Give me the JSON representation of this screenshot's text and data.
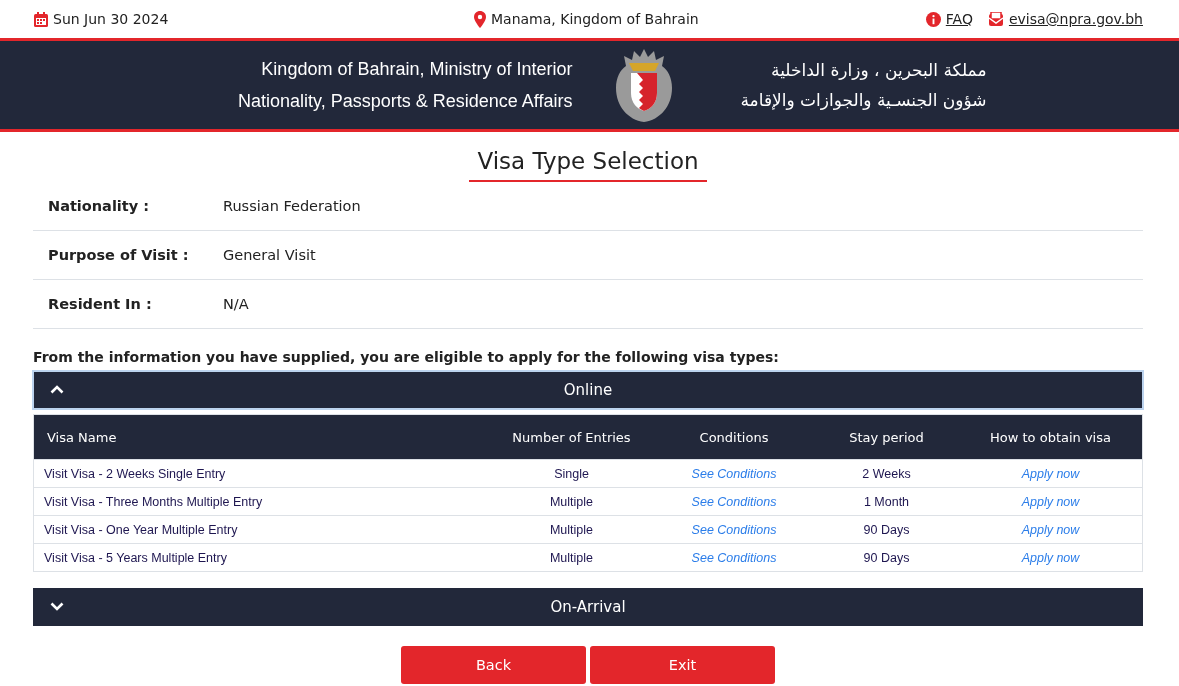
{
  "top_bar": {
    "date": "Sun Jun 30 2024",
    "location": "Manama, Kingdom of Bahrain",
    "faq": "FAQ",
    "email": "evisa@npra.gov.bh"
  },
  "header": {
    "english_lines": [
      "Kingdom of Bahrain, Ministry of Interior",
      "Nationality, Passports & Residence Affairs"
    ],
    "arabic_lines": [
      "مملكة البحرين ، وزارة الداخلية",
      "شؤون الجنسـية والجوازات والإقامة"
    ]
  },
  "page_title": "Visa Type Selection",
  "info": [
    {
      "label": "Nationality :",
      "value": "Russian Federation"
    },
    {
      "label": "Purpose of Visit :",
      "value": "General Visit"
    },
    {
      "label": "Resident In :",
      "value": "N/A"
    }
  ],
  "eligibility_text": "From the information you have supplied, you are eligible to apply for the following visa types:",
  "sections": [
    {
      "title": "Online",
      "expanded": true,
      "table": {
        "columns": [
          "Visa Name",
          "Number of Entries",
          "Conditions",
          "Stay period",
          "How to obtain visa"
        ],
        "rows": [
          {
            "name": "Visit Visa - 2 Weeks Single Entry",
            "entries": "Single",
            "conditions": "See Conditions",
            "stay": "2 Weeks",
            "action": "Apply now"
          },
          {
            "name": "Visit Visa - Three Months Multiple Entry",
            "entries": "Multiple",
            "conditions": "See Conditions",
            "stay": "1 Month",
            "action": "Apply now"
          },
          {
            "name": "Visit Visa - One Year Multiple Entry",
            "entries": "Multiple",
            "conditions": "See Conditions",
            "stay": "90 Days",
            "action": "Apply now"
          },
          {
            "name": "Visit Visa - 5 Years Multiple Entry",
            "entries": "Multiple",
            "conditions": "See Conditions",
            "stay": "90 Days",
            "action": "Apply now"
          }
        ]
      }
    },
    {
      "title": "On-Arrival",
      "expanded": false
    }
  ],
  "buttons": [
    "Back",
    "Exit"
  ]
}
